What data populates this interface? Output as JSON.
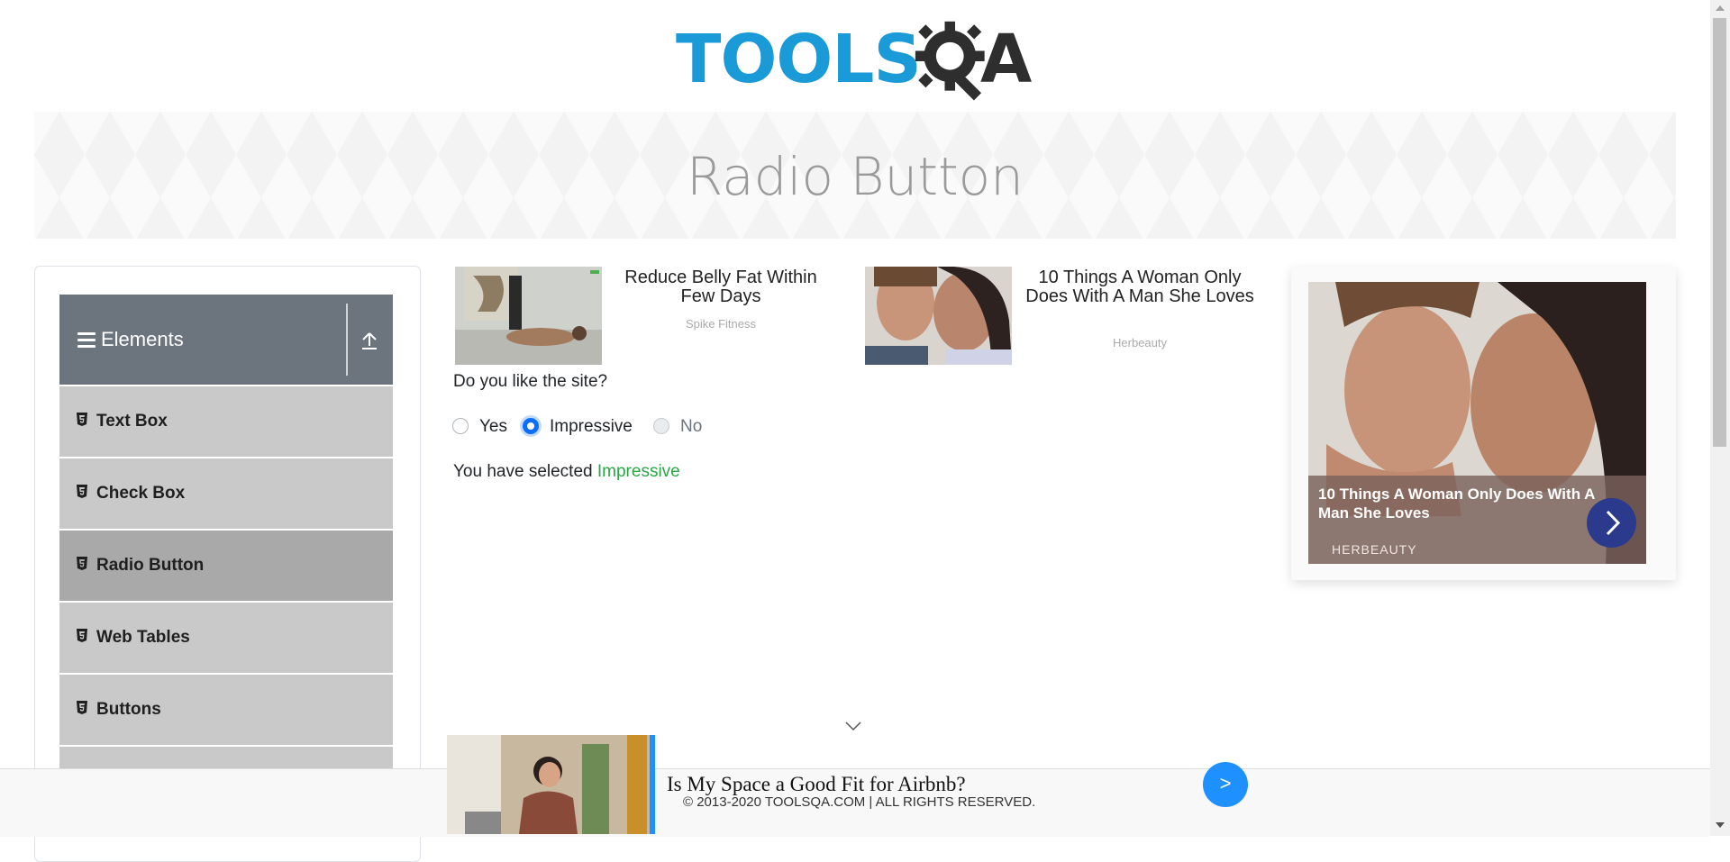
{
  "header": {
    "logo_text_primary": "TOOLS",
    "logo_text_secondary": "A"
  },
  "banner": {
    "title": "Radio Button"
  },
  "sidebar": {
    "group": {
      "title": "Elements",
      "icon": "hamburger-icon",
      "collapse_icon": "collapse-up-icon"
    },
    "items": [
      {
        "label": "Text Box",
        "icon": "html5-icon",
        "active": false
      },
      {
        "label": "Check Box",
        "icon": "html5-icon",
        "active": false
      },
      {
        "label": "Radio Button",
        "icon": "html5-icon",
        "active": true
      },
      {
        "label": "Web Tables",
        "icon": "html5-icon",
        "active": false
      },
      {
        "label": "Buttons",
        "icon": "html5-icon",
        "active": false
      }
    ]
  },
  "ads": [
    {
      "title": "Reduce Belly Fat Within Few Days",
      "source": "Spike Fitness"
    },
    {
      "title": "10 Things A Woman Only Does With A Man She Loves",
      "source": "Herbeauty"
    }
  ],
  "main": {
    "question": "Do you like the site?",
    "options": [
      {
        "label": "Yes",
        "checked": false,
        "disabled": false
      },
      {
        "label": "Impressive",
        "checked": true,
        "disabled": false
      },
      {
        "label": "No",
        "checked": false,
        "disabled": true
      }
    ],
    "result_prefix": "You have selected",
    "result_value": "Impressive"
  },
  "right_ad": {
    "title": "10 Things A Woman Only Does With A Man She Loves",
    "source": "HERBEAUTY"
  },
  "bottom_ad": {
    "title": "Is My Space a Good Fit for Airbnb?",
    "button_label": ">"
  },
  "footer": {
    "copyright": "© 2013-2020 TOOLSQA.COM | ALL RIGHTS RESERVED."
  },
  "colors": {
    "accent": "#0d6efd",
    "success": "#28a745",
    "sidebar_header": "#6c757d",
    "menu_item": "#c9c9c9",
    "menu_item_active": "#a9a9a9",
    "logo_blue": "#1a9ad6"
  }
}
